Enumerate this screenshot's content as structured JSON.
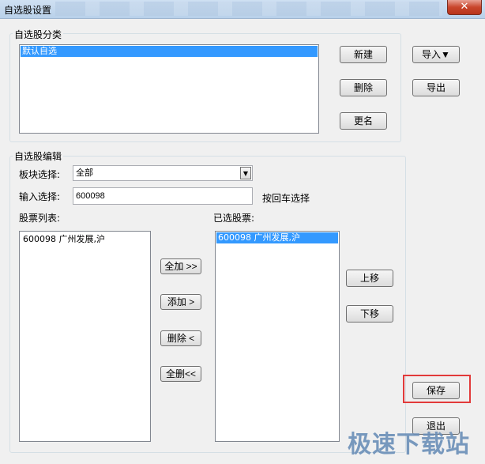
{
  "window": {
    "title": "自选股设置",
    "close_glyph": "✕"
  },
  "category_group": {
    "legend": "自选股分类",
    "items": [
      {
        "label": "默认自选",
        "selected": true
      }
    ],
    "buttons": {
      "new": "新建",
      "delete": "删除",
      "rename": "更名"
    }
  },
  "side_buttons": {
    "import": "导入▼",
    "export": "导出"
  },
  "edit_group": {
    "legend": "自选股编辑",
    "sector_label": "板块选择:",
    "sector_value": "全部",
    "input_label": "输入选择:",
    "input_value": "600098",
    "enter_hint": "按回车选择",
    "stock_list_label": "股票列表:",
    "stock_list": [
      {
        "label": "600098    广州发展,沪"
      }
    ],
    "selected_label": "已选股票:",
    "selected_list": [
      {
        "label": "600098    广州发展,沪",
        "selected": true
      }
    ],
    "buttons": {
      "add_all": "全加 >>",
      "add": "添加 >",
      "remove": "删除 <",
      "remove_all": "全删<<",
      "move_up": "上移",
      "move_down": "下移"
    }
  },
  "footer_buttons": {
    "save": "保存",
    "exit": "退出"
  },
  "watermark": "极速下载站"
}
